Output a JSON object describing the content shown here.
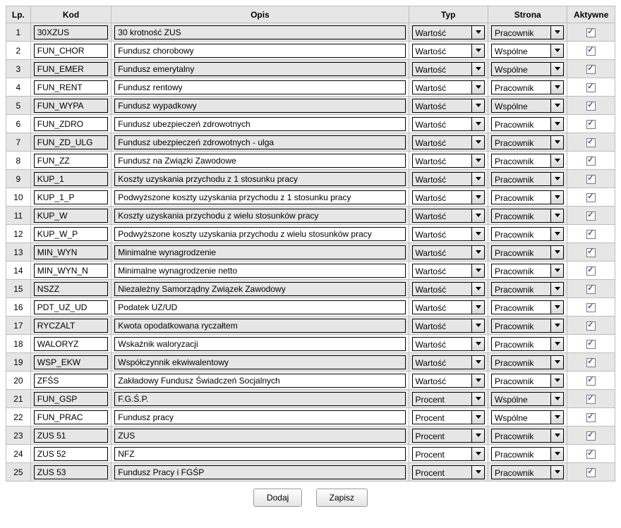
{
  "headers": {
    "lp": "Lp.",
    "kod": "Kod",
    "opis": "Opis",
    "typ": "Typ",
    "strona": "Strona",
    "aktywne": "Aktywne"
  },
  "rows": [
    {
      "lp": "1",
      "kod": "30XZUS",
      "opis": "30 krotność ZUS",
      "typ": "Wartość",
      "strona": "Pracownik",
      "aktywne": true
    },
    {
      "lp": "2",
      "kod": "FUN_CHOR",
      "opis": "Fundusz chorobowy",
      "typ": "Wartość",
      "strona": "Wspólne",
      "aktywne": true
    },
    {
      "lp": "3",
      "kod": "FUN_EMER",
      "opis": "Fundusz emerytalny",
      "typ": "Wartość",
      "strona": "Wspólne",
      "aktywne": true
    },
    {
      "lp": "4",
      "kod": "FUN_RENT",
      "opis": "Fundusz rentowy",
      "typ": "Wartość",
      "strona": "Pracownik",
      "aktywne": true
    },
    {
      "lp": "5",
      "kod": "FUN_WYPA",
      "opis": "Fundusz wypadkowy",
      "typ": "Wartość",
      "strona": "Wspólne",
      "aktywne": true
    },
    {
      "lp": "6",
      "kod": "FUN_ZDRO",
      "opis": "Fundusz ubezpieczeń zdrowotnych",
      "typ": "Wartość",
      "strona": "Pracownik",
      "aktywne": true
    },
    {
      "lp": "7",
      "kod": "FUN_ZD_ULG",
      "opis": "Fundusz ubezpieczeń zdrowotnych - ulga",
      "typ": "Wartość",
      "strona": "Pracownik",
      "aktywne": true
    },
    {
      "lp": "8",
      "kod": "FUN_ZZ",
      "opis": "Fundusz na Związki Zawodowe",
      "typ": "Wartość",
      "strona": "Pracownik",
      "aktywne": true
    },
    {
      "lp": "9",
      "kod": "KUP_1",
      "opis": "Koszty uzyskania przychodu z 1 stosunku pracy",
      "typ": "Wartość",
      "strona": "Pracownik",
      "aktywne": true
    },
    {
      "lp": "10",
      "kod": "KUP_1_P",
      "opis": "Podwyższone koszty uzyskania przychodu z 1 stosunku pracy",
      "typ": "Wartość",
      "strona": "Pracownik",
      "aktywne": true
    },
    {
      "lp": "11",
      "kod": "KUP_W",
      "opis": "Koszty uzyskania przychodu z wielu stosunków pracy",
      "typ": "Wartość",
      "strona": "Pracownik",
      "aktywne": true
    },
    {
      "lp": "12",
      "kod": "KUP_W_P",
      "opis": "Podwyższone koszty uzyskania przychodu z wielu stosunków pracy",
      "typ": "Wartość",
      "strona": "Pracownik",
      "aktywne": true
    },
    {
      "lp": "13",
      "kod": "MIN_WYN",
      "opis": "Minimalne wynagrodzenie",
      "typ": "Wartość",
      "strona": "Pracownik",
      "aktywne": true
    },
    {
      "lp": "14",
      "kod": "MIN_WYN_N",
      "opis": "Minimalne wynagrodzenie netto",
      "typ": "Wartość",
      "strona": "Pracownik",
      "aktywne": true
    },
    {
      "lp": "15",
      "kod": "NSZZ",
      "opis": "Niezależny Samorządny Związek Zawodowy",
      "typ": "Wartość",
      "strona": "Pracownik",
      "aktywne": true
    },
    {
      "lp": "16",
      "kod": "PDT_UZ_UD",
      "opis": "Podatek UZ/UD",
      "typ": "Wartość",
      "strona": "Pracownik",
      "aktywne": true
    },
    {
      "lp": "17",
      "kod": "RYCZALT",
      "opis": "Kwota opodatkowana ryczałtem",
      "typ": "Wartość",
      "strona": "Pracownik",
      "aktywne": true
    },
    {
      "lp": "18",
      "kod": "WALORYZ",
      "opis": "Wskaźnik waloryzacji",
      "typ": "Wartość",
      "strona": "Pracownik",
      "aktywne": true
    },
    {
      "lp": "19",
      "kod": "WSP_EKW",
      "opis": "Współczynnik ekwiwalentowy",
      "typ": "Wartość",
      "strona": "Pracownik",
      "aktywne": true
    },
    {
      "lp": "20",
      "kod": "ZFŚS",
      "opis": "Zakładowy Fundusz Świadczeń Socjalnych",
      "typ": "Wartość",
      "strona": "Pracownik",
      "aktywne": true
    },
    {
      "lp": "21",
      "kod": "FUN_GSP",
      "opis": "F.G.Ś.P.",
      "typ": "Procent",
      "strona": "Wspólne",
      "aktywne": true
    },
    {
      "lp": "22",
      "kod": "FUN_PRAC",
      "opis": "Fundusz pracy",
      "typ": "Procent",
      "strona": "Wspólne",
      "aktywne": true
    },
    {
      "lp": "23",
      "kod": "ZUS 51",
      "opis": "ZUS",
      "typ": "Procent",
      "strona": "Pracownik",
      "aktywne": true
    },
    {
      "lp": "24",
      "kod": "ZUS 52",
      "opis": "NFZ",
      "typ": "Procent",
      "strona": "Pracownik",
      "aktywne": true
    },
    {
      "lp": "25",
      "kod": "ZUS 53",
      "opis": "Fundusz Pracy i FGŚP",
      "typ": "Procent",
      "strona": "Pracownik",
      "aktywne": true
    }
  ],
  "buttons": {
    "add": "Dodaj",
    "save": "Zapisz"
  }
}
